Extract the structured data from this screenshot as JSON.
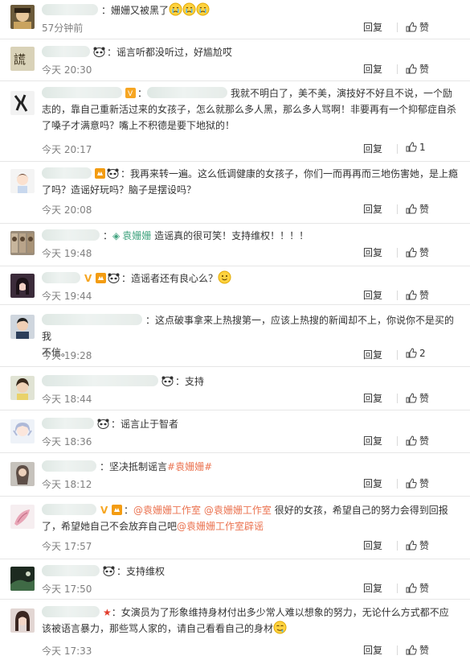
{
  "comments": [
    {
      "id": "c1",
      "name_w": 70,
      "text": "姗姗又被黑了",
      "time": "57分钟前",
      "reply": "回复",
      "like": "赞",
      "emoji_count": 3,
      "emoji": "😭"
    },
    {
      "id": "c2",
      "name_w": 60,
      "text": "谣言听都没听过，好尴尬哎",
      "time": "今天 20:30",
      "reply": "回复",
      "like": "赞"
    },
    {
      "id": "c3",
      "name_w": 100,
      "reply_to_w": 100,
      "line1": "我就不明白了，美不美，演技好不好且不说，一个励",
      "line2": "志的，靠自己重新活过来的女孩子，怎么就那么多人黑，那么多人骂啊！非要再有一个抑郁症自杀",
      "line3": "了嗓子才满意吗？嘴上不积德是要下地狱的！",
      "time": "今天 20:17",
      "reply": "回复",
      "like": "1"
    },
    {
      "id": "c4",
      "name_w": 62,
      "line1": "我再来转一遍。这么低调健康的女孩子，你们一而再再而三地伤害她，是上瘾",
      "line2": "了吗？造谣好玩吗？脑子是摆设吗？",
      "time": "今天 20:08",
      "reply": "回复",
      "like": "赞"
    },
    {
      "id": "c5",
      "name_w": 72,
      "mention": "袁姗姗",
      "text": "造谣真的很可笑！支持维权！！！！",
      "time": "今天 19:48",
      "reply": "回复",
      "like": "赞"
    },
    {
      "id": "c6",
      "name_w": 48,
      "text": "造谣者还有良心么？",
      "time": "今天 19:44",
      "reply": "回复",
      "like": "赞",
      "emoji": "🙂"
    },
    {
      "id": "c7",
      "name_w": 125,
      "line1": "这点破事拿来上热搜第一，应该上热搜的新闻却不上，你说你不是买的我",
      "line2": "不信。",
      "time": "今天 19:28",
      "reply": "回复",
      "like": "2"
    },
    {
      "id": "c8",
      "name_w": 145,
      "text": "支持",
      "time": "今天 18:44",
      "reply": "回复",
      "like": "赞"
    },
    {
      "id": "c9",
      "name_w": 65,
      "text": "谣言止于智者",
      "time": "今天 18:36",
      "reply": "回复",
      "like": "赞"
    },
    {
      "id": "c10",
      "name_w": 68,
      "text": "坚决抵制谣言",
      "hashtag": "#袁姗姗#",
      "time": "今天 18:12",
      "reply": "回复",
      "like": "赞"
    },
    {
      "id": "c11",
      "name_w": 68,
      "mention1": "@袁姗姗工作室",
      "mention2": "@袁姗姗工作室",
      "line1_rest": "很好的女孩，希望自己的努力会得到回报",
      "line2_start": "了，希望她自己不会放弃自己吧",
      "mention3": "@袁姗姗工作室辟谣",
      "time": "今天 17:57",
      "reply": "回复",
      "like": "赞"
    },
    {
      "id": "c12",
      "name_w": 72,
      "text": "支持维权",
      "time": "今天 17:50",
      "reply": "回复",
      "like": "赞"
    },
    {
      "id": "c13",
      "name_w": 72,
      "line1": "女演员为了形象维持身材付出多少常人难以想象的努力，无论什么方式都不应",
      "line2": "该被语言暴力，那些骂人家的，请自己看看自己的身材",
      "time": "今天 17:33",
      "reply": "回复",
      "like": "赞",
      "emoji": "🤤"
    }
  ],
  "colors": {
    "link": "#eb7350",
    "text": "#333333",
    "muted": "#808080",
    "border": "#e6e6e6",
    "verified": "#f6a623"
  }
}
